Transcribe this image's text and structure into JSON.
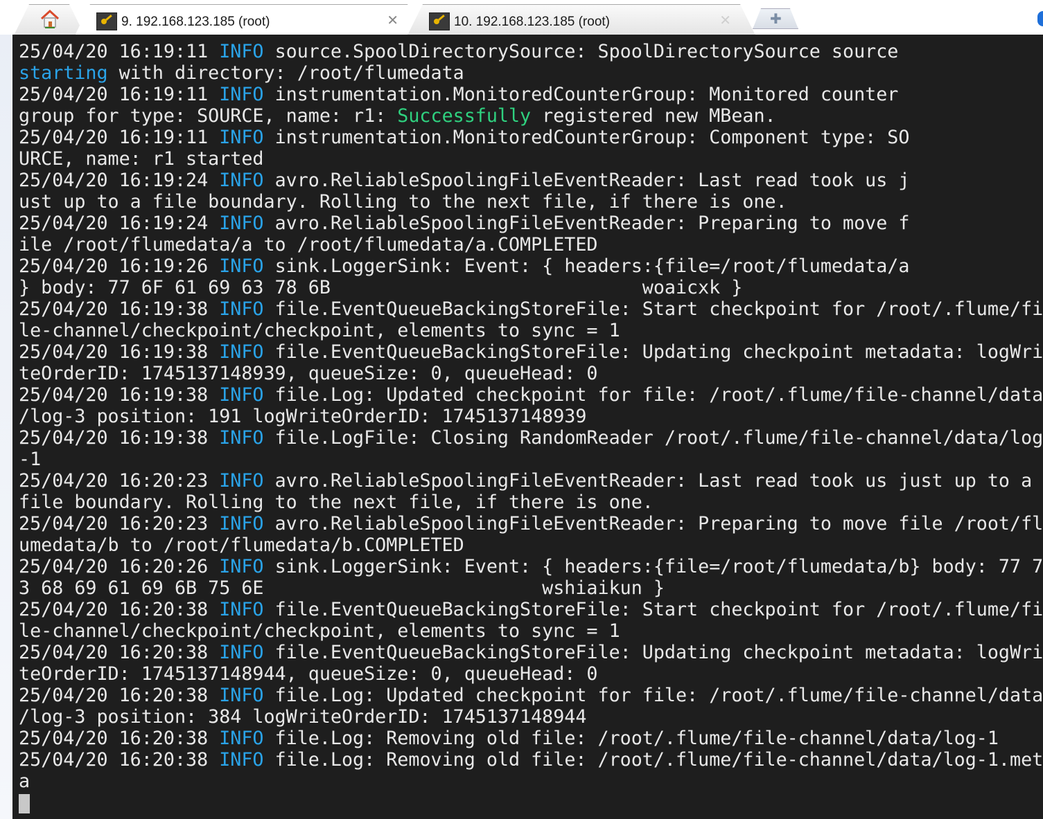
{
  "tabs": [
    {
      "label": "",
      "kind": "home"
    },
    {
      "label": "9. 192.168.123.185 (root)",
      "active": true
    },
    {
      "label": "10. 192.168.123.185 (root)",
      "active": false
    },
    {
      "label": "",
      "kind": "new-tab"
    }
  ],
  "terminal": {
    "lines": [
      {
        "prefix": "25/04/20 16:19:11 ",
        "level": "INFO",
        "text": " source.SpoolDirectorySource: SpoolDirectorySource source"
      },
      {
        "cyan": "starting",
        "text": " with directory: /root/flumedata"
      },
      {
        "prefix": "25/04/20 16:19:11 ",
        "level": "INFO",
        "text": " instrumentation.MonitoredCounterGroup: Monitored counter"
      },
      {
        "text": "group for type: SOURCE, name: r1: ",
        "green": "Successfully",
        "text2": " registered new MBean."
      },
      {
        "prefix": "25/04/20 16:19:11 ",
        "level": "INFO",
        "text": " instrumentation.MonitoredCounterGroup: Component type: SO"
      },
      {
        "text": "URCE, name: r1 started"
      },
      {
        "prefix": "25/04/20 16:19:24 ",
        "level": "INFO",
        "text": " avro.ReliableSpoolingFileEventReader: Last read took us j"
      },
      {
        "text": "ust up to a file boundary. Rolling to the next file, if there is one."
      },
      {
        "prefix": "25/04/20 16:19:24 ",
        "level": "INFO",
        "text": " avro.ReliableSpoolingFileEventReader: Preparing to move f"
      },
      {
        "text": "ile /root/flumedata/a to /root/flumedata/a.COMPLETED"
      },
      {
        "prefix": "25/04/20 16:19:26 ",
        "level": "INFO",
        "text": " sink.LoggerSink: Event: { headers:{file=/root/flumedata/a"
      },
      {
        "text": "} body: 77 6F 61 69 63 78 6B                            woaicxk }"
      },
      {
        "prefix": "25/04/20 16:19:38 ",
        "level": "INFO",
        "text": " file.EventQueueBackingStoreFile: Start checkpoint for /root/.flume/fi"
      },
      {
        "text": "le-channel/checkpoint/checkpoint, elements to sync = 1"
      },
      {
        "prefix": "25/04/20 16:19:38 ",
        "level": "INFO",
        "text": " file.EventQueueBackingStoreFile: Updating checkpoint metadata: logWri"
      },
      {
        "text": "teOrderID: 1745137148939, queueSize: 0, queueHead: 0"
      },
      {
        "prefix": "25/04/20 16:19:38 ",
        "level": "INFO",
        "text": " file.Log: Updated checkpoint for file: /root/.flume/file-channel/data"
      },
      {
        "text": "/log-3 position: 191 logWriteOrderID: 1745137148939"
      },
      {
        "prefix": "25/04/20 16:19:38 ",
        "level": "INFO",
        "text": " file.LogFile: Closing RandomReader /root/.flume/file-channel/data/log"
      },
      {
        "text": "-1"
      },
      {
        "prefix": "25/04/20 16:20:23 ",
        "level": "INFO",
        "text": " avro.ReliableSpoolingFileEventReader: Last read took us just up to a"
      },
      {
        "text": "file boundary. Rolling to the next file, if there is one."
      },
      {
        "prefix": "25/04/20 16:20:23 ",
        "level": "INFO",
        "text": " avro.ReliableSpoolingFileEventReader: Preparing to move file /root/fl"
      },
      {
        "text": "umedata/b to /root/flumedata/b.COMPLETED"
      },
      {
        "prefix": "25/04/20 16:20:26 ",
        "level": "INFO",
        "text": " sink.LoggerSink: Event: { headers:{file=/root/flumedata/b} body: 77 7"
      },
      {
        "text": "3 68 69 61 69 6B 75 6E                         wshiaikun }"
      },
      {
        "prefix": "25/04/20 16:20:38 ",
        "level": "INFO",
        "text": " file.EventQueueBackingStoreFile: Start checkpoint for /root/.flume/fi"
      },
      {
        "text": "le-channel/checkpoint/checkpoint, elements to sync = 1"
      },
      {
        "prefix": "25/04/20 16:20:38 ",
        "level": "INFO",
        "text": " file.EventQueueBackingStoreFile: Updating checkpoint metadata: logWri"
      },
      {
        "text": "teOrderID: 1745137148944, queueSize: 0, queueHead: 0"
      },
      {
        "prefix": "25/04/20 16:20:38 ",
        "level": "INFO",
        "text": " file.Log: Updated checkpoint for file: /root/.flume/file-channel/data"
      },
      {
        "text": "/log-3 position: 384 logWriteOrderID: 1745137148944"
      },
      {
        "prefix": "25/04/20 16:20:38 ",
        "level": "INFO",
        "text": " file.Log: Removing old file: /root/.flume/file-channel/data/log-1"
      },
      {
        "prefix": "25/04/20 16:20:38 ",
        "level": "INFO",
        "text": " file.Log: Removing old file: /root/.flume/file-channel/data/log-1.met"
      },
      {
        "text": "a"
      }
    ]
  },
  "icons": {
    "home": "home-icon",
    "session": "key-icon",
    "close": "close-icon",
    "new_tab": "plus-icon"
  },
  "colors": {
    "terminal_bg": "#1e1e1e",
    "terminal_fg": "#e8e8e8",
    "info": "#2aa3e8",
    "success": "#2fd17f"
  }
}
